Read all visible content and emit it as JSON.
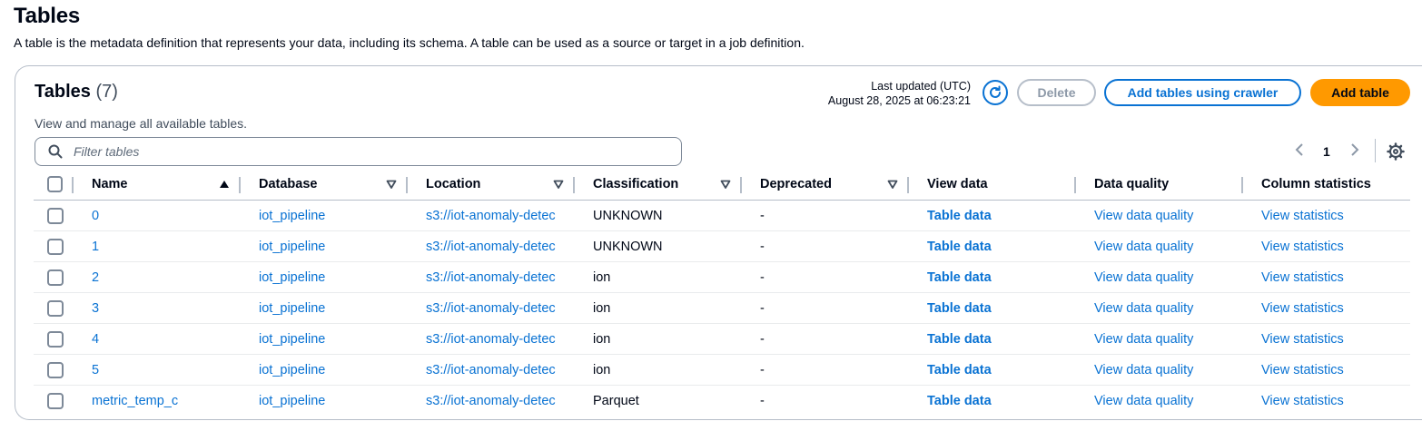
{
  "page": {
    "title": "Tables",
    "description": "A table is the metadata definition that represents your data, including its schema. A table can be used as a source or target in a job definition."
  },
  "panel": {
    "title": "Tables",
    "count": "(7)",
    "subtitle": "View and manage all available tables.",
    "last_updated_label": "Last updated (UTC)",
    "last_updated_value": "August 28, 2025 at 06:23:21",
    "buttons": {
      "delete": "Delete",
      "add_crawler": "Add tables using crawler",
      "add_table": "Add table"
    },
    "filter_placeholder": "Filter tables",
    "pagination": {
      "current_page": "1"
    }
  },
  "table": {
    "columns": [
      "Name",
      "Database",
      "Location",
      "Classification",
      "Deprecated",
      "View data",
      "Data quality",
      "Column statistics"
    ],
    "rows": [
      {
        "name": "0",
        "database": "iot_pipeline",
        "location": "s3://iot-anomaly-detec",
        "classification": "UNKNOWN",
        "deprecated": "-",
        "view_data": "Table data",
        "data_quality": "View data quality",
        "column_statistics": "View statistics"
      },
      {
        "name": "1",
        "database": "iot_pipeline",
        "location": "s3://iot-anomaly-detec",
        "classification": "UNKNOWN",
        "deprecated": "-",
        "view_data": "Table data",
        "data_quality": "View data quality",
        "column_statistics": "View statistics"
      },
      {
        "name": "2",
        "database": "iot_pipeline",
        "location": "s3://iot-anomaly-detec",
        "classification": "ion",
        "deprecated": "-",
        "view_data": "Table data",
        "data_quality": "View data quality",
        "column_statistics": "View statistics"
      },
      {
        "name": "3",
        "database": "iot_pipeline",
        "location": "s3://iot-anomaly-detec",
        "classification": "ion",
        "deprecated": "-",
        "view_data": "Table data",
        "data_quality": "View data quality",
        "column_statistics": "View statistics"
      },
      {
        "name": "4",
        "database": "iot_pipeline",
        "location": "s3://iot-anomaly-detec",
        "classification": "ion",
        "deprecated": "-",
        "view_data": "Table data",
        "data_quality": "View data quality",
        "column_statistics": "View statistics"
      },
      {
        "name": "5",
        "database": "iot_pipeline",
        "location": "s3://iot-anomaly-detec",
        "classification": "ion",
        "deprecated": "-",
        "view_data": "Table data",
        "data_quality": "View data quality",
        "column_statistics": "View statistics"
      },
      {
        "name": "metric_temp_c",
        "database": "iot_pipeline",
        "location": "s3://iot-anomaly-detec",
        "classification": "Parquet",
        "deprecated": "-",
        "view_data": "Table data",
        "data_quality": "View data quality",
        "column_statistics": "View statistics"
      }
    ]
  },
  "colors": {
    "link": "#0972d3",
    "primary_button": "#ff9900",
    "border": "#b6bec9",
    "text": "#000716"
  },
  "icons": {
    "refresh": "refresh-icon",
    "search": "search-icon",
    "settings": "gear-icon",
    "sort_asc": "sort-ascending-icon",
    "sort_none": "sort-unsorted-icon",
    "prev": "chevron-left-icon",
    "next": "chevron-right-icon"
  }
}
